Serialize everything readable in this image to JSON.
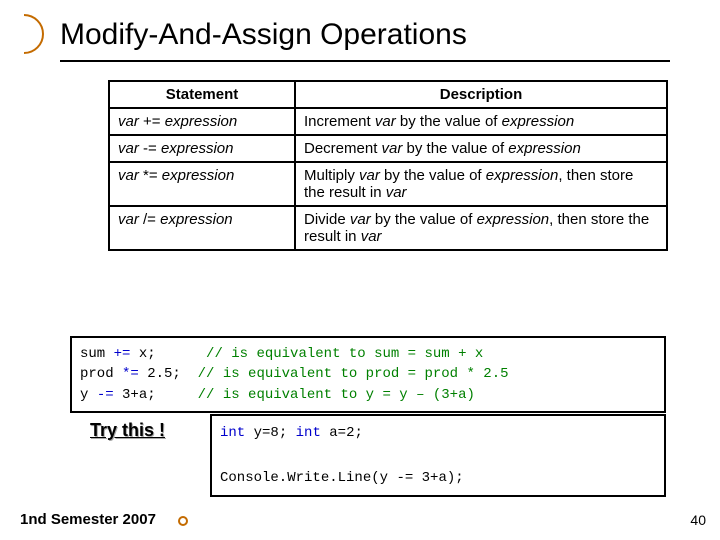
{
  "title": "Modify-And-Assign Operations",
  "table": {
    "headers": [
      "Statement",
      "Description"
    ],
    "rows": [
      {
        "stmt_var": "var",
        "stmt_op": " += ",
        "stmt_expr": "expression",
        "desc_pre": "Increment ",
        "desc_var": "var",
        "desc_mid": " by the value of ",
        "desc_expr": "expression",
        "desc_post": ""
      },
      {
        "stmt_var": "var",
        "stmt_op": " -= ",
        "stmt_expr": "expression",
        "desc_pre": "Decrement ",
        "desc_var": "var",
        "desc_mid": " by the value of ",
        "desc_expr": "expression",
        "desc_post": ""
      },
      {
        "stmt_var": "var",
        "stmt_op": " *= ",
        "stmt_expr": "expression",
        "desc_pre": "Multiply ",
        "desc_var": "var",
        "desc_mid": " by the value of ",
        "desc_expr": "expression",
        "desc_post": ", then store the result in ",
        "desc_var2": "var"
      },
      {
        "stmt_var": "var",
        "stmt_op": " /= ",
        "stmt_expr": "expression",
        "desc_pre": "Divide ",
        "desc_var": "var",
        "desc_mid": " by the value of ",
        "desc_expr": "expression",
        "desc_post": ", then store the result in ",
        "desc_var2": "var"
      }
    ]
  },
  "code1": {
    "l1a": "sum ",
    "l1b": "+=",
    "l1c": " x;      ",
    "l1d": "// is equivalent to sum = sum + x",
    "l2a": "prod ",
    "l2b": "*=",
    "l2c": " 2.5;  ",
    "l2d": "// is equivalent to prod = prod * 2.5",
    "l3a": "y ",
    "l3b": "-=",
    "l3c": " 3+a;     ",
    "l3d": "// is equivalent to y = y – (3+a)"
  },
  "try_label": "Try this !",
  "code2": {
    "l1a": "int",
    "l1b": " y=8; ",
    "l1c": "int",
    "l1d": " a=2;",
    "l2a": "Console.",
    "l2b": "Write.Line",
    "l2c": "(y -= 3+a);"
  },
  "footer_left": "1nd Semester 2007",
  "footer_right": "40"
}
